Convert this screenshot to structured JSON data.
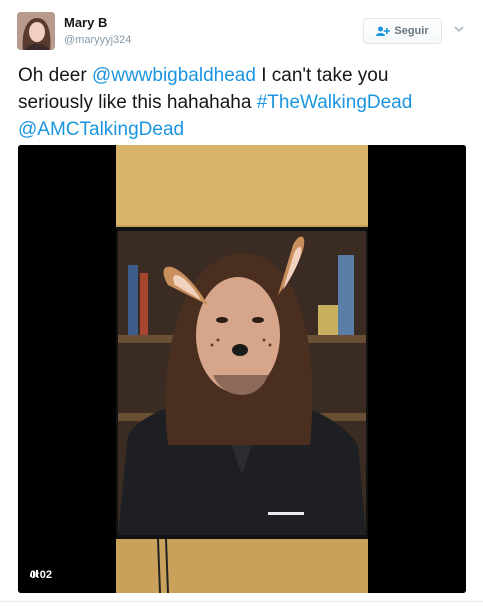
{
  "user": {
    "name": "Mary B",
    "handle": "@maryyyj324"
  },
  "follow_button": {
    "label": "Seguir"
  },
  "tweet": {
    "segments": [
      {
        "text": "Oh deer ",
        "link": false
      },
      {
        "text": "@wwwbigbaldhead",
        "link": true
      },
      {
        "text": " I can't take you seriously like this hahahaha ",
        "link": false
      },
      {
        "text": "#TheWalkingDead",
        "link": true
      },
      {
        "text": " ",
        "link": false
      },
      {
        "text": "@AMCTalkingDead",
        "link": true
      }
    ]
  },
  "video": {
    "timestamp": "0:02"
  },
  "colors": {
    "link": "#1b95e0",
    "text": "#14171a",
    "muted": "#8899a6"
  }
}
